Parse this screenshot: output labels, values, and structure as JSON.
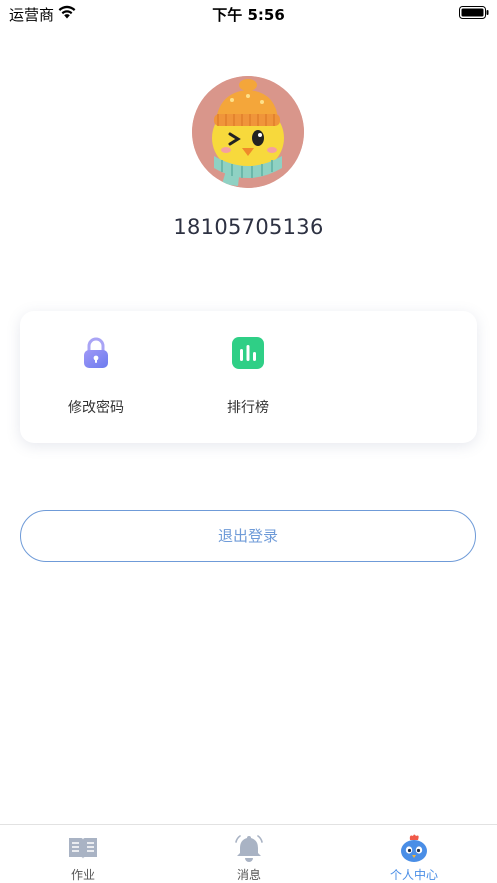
{
  "status_bar": {
    "carrier": "运营商",
    "time": "下午 5:56"
  },
  "profile": {
    "phone": "18105705136"
  },
  "menu": {
    "items": [
      {
        "label": "修改密码",
        "icon": "lock-icon"
      },
      {
        "label": "排行榜",
        "icon": "bar-chart-icon"
      }
    ]
  },
  "logout_label": "退出登录",
  "tabbar": {
    "tabs": [
      {
        "label": "作业",
        "icon": "book-icon",
        "active": false
      },
      {
        "label": "消息",
        "icon": "bell-icon",
        "active": false
      },
      {
        "label": "个人中心",
        "icon": "mascot-icon",
        "active": true
      }
    ]
  },
  "colors": {
    "accent": "#6f9bd8",
    "active_tab": "#4a8ee6",
    "rank_green": "#2fcf86",
    "lock_purple": "#7f7ff0",
    "avatar_bg": "#d9968b"
  }
}
